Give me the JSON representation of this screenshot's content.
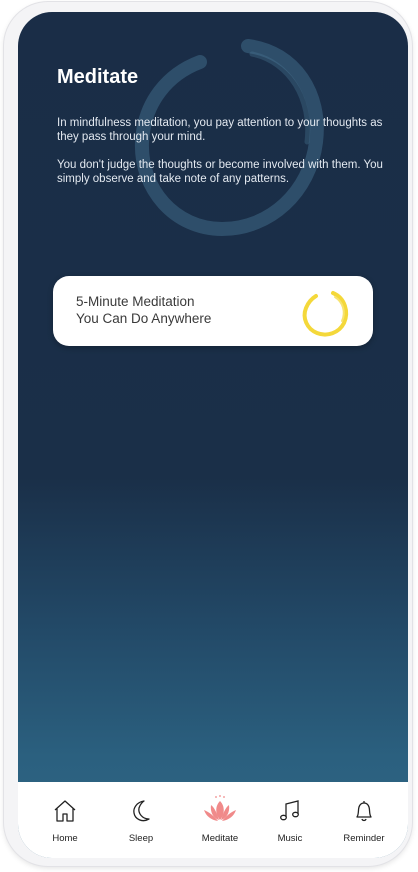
{
  "screen": {
    "title": "Meditate",
    "description_1": "In mindfulness meditation, you pay attention to your thoughts as they pass through your mind.",
    "description_2": "You don't judge the thoughts or become involved with them. You simply observe and take note of any patterns."
  },
  "card": {
    "line_1": "5-Minute Meditation",
    "line_2": "You Can Do Anywhere",
    "icon": "enso-circle-icon",
    "accent": "#f4d83a"
  },
  "tabbar": {
    "active": "Meditate",
    "active_color": "#f08a8a",
    "tabs": [
      {
        "label": "Home",
        "icon": "home-icon"
      },
      {
        "label": "Sleep",
        "icon": "moon-icon"
      },
      {
        "label": "Meditate",
        "icon": "lotus-icon"
      },
      {
        "label": "Music",
        "icon": "music-note-icon"
      },
      {
        "label": "Reminder",
        "icon": "bell-icon"
      }
    ]
  },
  "colors": {
    "background_top": "#1a2d47",
    "background_bottom": "#2e6684",
    "card": "#ffffff"
  }
}
